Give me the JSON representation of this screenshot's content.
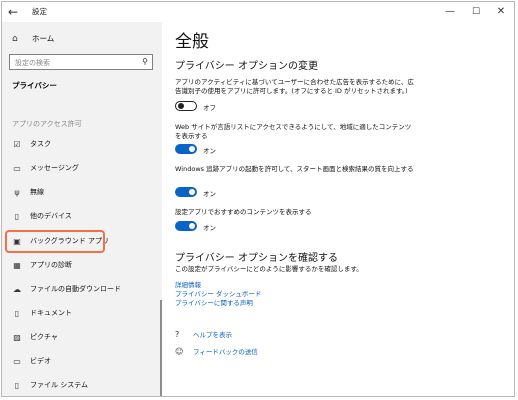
{
  "window": {
    "title": "設定",
    "back_icon": "back-arrow-icon",
    "controls": [
      "—",
      "☐",
      "✕"
    ]
  },
  "sidebar": {
    "home": "ホーム",
    "search_placeholder": "設定の検索",
    "section": "プライバシー",
    "group": "アプリのアクセス許可",
    "items": [
      {
        "label": "タスク",
        "icon": "task-icon"
      },
      {
        "label": "メッセージング",
        "icon": "message-icon"
      },
      {
        "label": "無線",
        "icon": "radio-icon"
      },
      {
        "label": "他のデバイス",
        "icon": "device-icon"
      },
      {
        "label": "バックグラウンド アプリ",
        "icon": "background-apps-icon",
        "selected": true
      },
      {
        "label": "アプリの診断",
        "icon": "diagnostics-icon"
      },
      {
        "label": "ファイルの自動ダウンロード",
        "icon": "cloud-icon"
      },
      {
        "label": "ドキュメント",
        "icon": "document-icon"
      },
      {
        "label": "ピクチャ",
        "icon": "picture-icon"
      },
      {
        "label": "ビデオ",
        "icon": "video-icon"
      },
      {
        "label": "ファイル システム",
        "icon": "file-icon"
      }
    ]
  },
  "main": {
    "title": "全般",
    "subtitle": "プライバシー オプションの変更",
    "settings": [
      {
        "text": "アプリのアクティビティに基づいてユーザーに合わせた広告を表示するために、広告識別子の使用をアプリに許可します。(オフにすると ID がリセットされます。)",
        "state": "オフ",
        "on": false
      },
      {
        "text": "Web サイトが言語リストにアクセスできるようにして、地域に適したコンテンツを表示する",
        "state": "オン",
        "on": true
      },
      {
        "text": "Windows 追跡アプリの起動を許可して、スタート画面と検索結果の質を向上する",
        "state": "オン",
        "on": true
      },
      {
        "text": "設定アプリでおすすめのコンテンツを表示する",
        "state": "オン",
        "on": true
      }
    ],
    "confirm_title": "プライバシー オプションを確認する",
    "confirm_desc": "この設定がプライバシーにどのように影響するかを確認します。",
    "links": [
      "詳細情報",
      "プライバシー ダッシュボード",
      "プライバシーに関する声明"
    ],
    "help": "ヘルプを表示",
    "feedback": "フィードバックの送信"
  },
  "colors": {
    "accent": "#0a64c8",
    "highlight": "#f0714c",
    "sidebar_bg": "#f2f2f2"
  }
}
